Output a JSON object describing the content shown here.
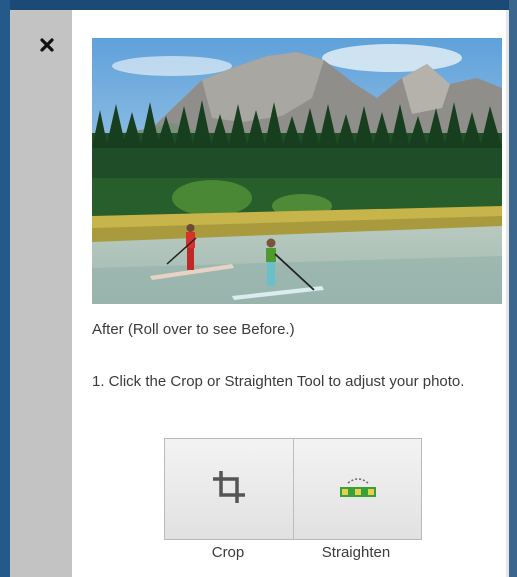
{
  "close": {
    "icon": "close-icon"
  },
  "preview": {
    "caption": "After (Roll over to see Before.)"
  },
  "steps": {
    "step1": "1. Click the Crop or Straighten Tool to adjust your photo."
  },
  "tools": {
    "crop": {
      "label": "Crop",
      "icon": "crop-icon"
    },
    "straighten": {
      "label": "Straighten",
      "icon": "straighten-icon"
    }
  },
  "colors": {
    "background": "#1f4e7c",
    "rail": "#c3c3c3",
    "panel": "#ffffff",
    "text": "#3b3b3b",
    "straighten_accent": "#3aa13a"
  }
}
